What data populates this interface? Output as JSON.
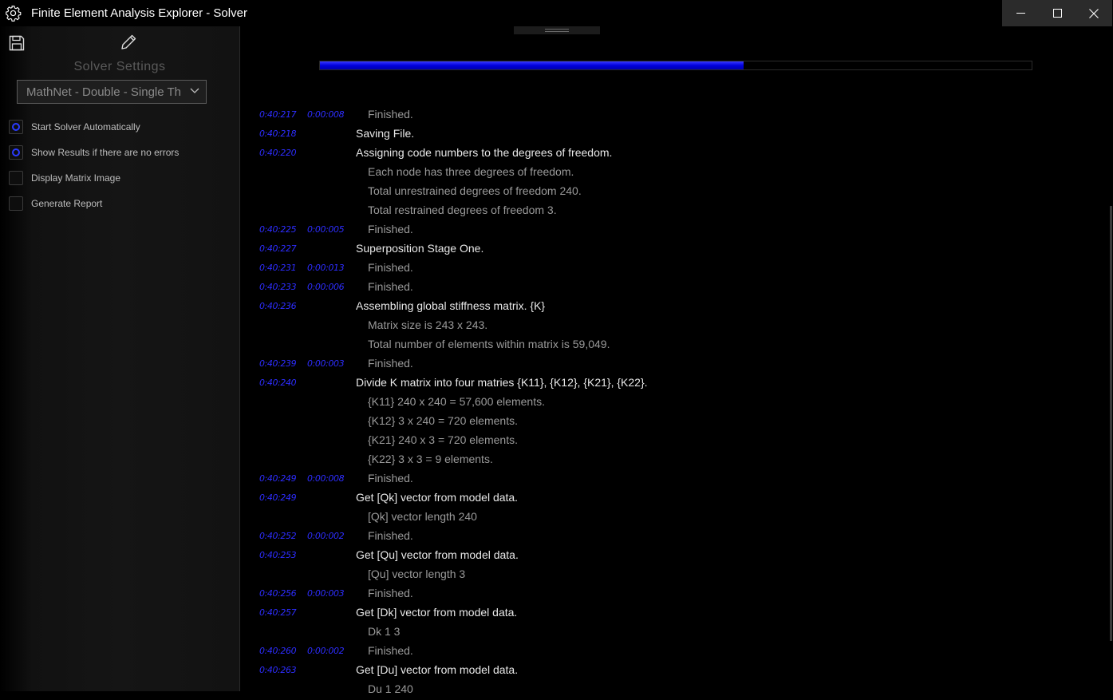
{
  "window": {
    "title": "Finite Element Analysis Explorer - Solver",
    "app_icon": "gear-icon",
    "controls": [
      "minimize-icon",
      "maximize-icon",
      "close-icon"
    ]
  },
  "sidebar": {
    "toolbar": {
      "save_icon": "save-icon",
      "edit_icon": "pencil-icon"
    },
    "settings_title": "Solver Settings",
    "solver_select": {
      "value": "MathNet - Double - Single Th"
    },
    "options": [
      {
        "label": "Start Solver Automatically",
        "checked": true
      },
      {
        "label": "Show Results if there are no errors",
        "checked": true
      },
      {
        "label": "Display Matrix Image",
        "checked": false
      },
      {
        "label": "Generate Report",
        "checked": false
      }
    ]
  },
  "progress": {
    "fraction": 0.595,
    "color": "#0000dd"
  },
  "log": [
    {
      "time": "0:40:217",
      "elapsed": "0:00:008",
      "message": "Finished.",
      "level": "sub"
    },
    {
      "time": "0:40:218",
      "elapsed": "",
      "message": "Saving File.",
      "level": "head"
    },
    {
      "time": "0:40:220",
      "elapsed": "",
      "message": "Assigning code numbers to the degrees of freedom.",
      "level": "head"
    },
    {
      "time": "",
      "elapsed": "",
      "message": "Each node has three degrees of freedom.",
      "level": "sub"
    },
    {
      "time": "",
      "elapsed": "",
      "message": "Total unrestrained degrees of freedom 240.",
      "level": "sub"
    },
    {
      "time": "",
      "elapsed": "",
      "message": "Total restrained degrees of freedom 3.",
      "level": "sub"
    },
    {
      "time": "0:40:225",
      "elapsed": "0:00:005",
      "message": "Finished.",
      "level": "sub"
    },
    {
      "time": "0:40:227",
      "elapsed": "",
      "message": "Superposition Stage One.",
      "level": "head"
    },
    {
      "time": "0:40:231",
      "elapsed": "0:00:013",
      "message": "Finished.",
      "level": "sub"
    },
    {
      "time": "0:40:233",
      "elapsed": "0:00:006",
      "message": "Finished.",
      "level": "sub"
    },
    {
      "time": "0:40:236",
      "elapsed": "",
      "message": "Assembling global stiffness matrix. {K}",
      "level": "head"
    },
    {
      "time": "",
      "elapsed": "",
      "message": "Matrix size is 243 x 243.",
      "level": "sub"
    },
    {
      "time": "",
      "elapsed": "",
      "message": "Total number of elements within matrix is 59,049.",
      "level": "sub"
    },
    {
      "time": "0:40:239",
      "elapsed": "0:00:003",
      "message": "Finished.",
      "level": "sub"
    },
    {
      "time": "0:40:240",
      "elapsed": "",
      "message": "Divide K matrix into four matries {K11}, {K12}, {K21}, {K22}.",
      "level": "head"
    },
    {
      "time": "",
      "elapsed": "",
      "message": "{K11} 240 x 240 = 57,600 elements.",
      "level": "sub"
    },
    {
      "time": "",
      "elapsed": "",
      "message": "{K12} 3 x 240 = 720 elements.",
      "level": "sub"
    },
    {
      "time": "",
      "elapsed": "",
      "message": "{K21} 240 x 3 = 720 elements.",
      "level": "sub"
    },
    {
      "time": "",
      "elapsed": "",
      "message": "{K22} 3 x 3 = 9 elements.",
      "level": "sub"
    },
    {
      "time": "0:40:249",
      "elapsed": "0:00:008",
      "message": "Finished.",
      "level": "sub"
    },
    {
      "time": "0:40:249",
      "elapsed": "",
      "message": "Get [Qk] vector from model data.",
      "level": "head"
    },
    {
      "time": "",
      "elapsed": "",
      "message": "[Qk] vector length 240",
      "level": "sub"
    },
    {
      "time": "0:40:252",
      "elapsed": "0:00:002",
      "message": "Finished.",
      "level": "sub"
    },
    {
      "time": "0:40:253",
      "elapsed": "",
      "message": "Get [Qu] vector from model data.",
      "level": "head"
    },
    {
      "time": "",
      "elapsed": "",
      "message": "[Qu] vector length 3",
      "level": "sub"
    },
    {
      "time": "0:40:256",
      "elapsed": "0:00:003",
      "message": "Finished.",
      "level": "sub"
    },
    {
      "time": "0:40:257",
      "elapsed": "",
      "message": "Get [Dk] vector from model data.",
      "level": "head"
    },
    {
      "time": "",
      "elapsed": "",
      "message": "Dk 1 3",
      "level": "sub"
    },
    {
      "time": "0:40:260",
      "elapsed": "0:00:002",
      "message": "Finished.",
      "level": "sub"
    },
    {
      "time": "0:40:263",
      "elapsed": "",
      "message": "Get [Du] vector from model data.",
      "level": "head"
    },
    {
      "time": "",
      "elapsed": "",
      "message": "Du 1 240",
      "level": "sub"
    }
  ]
}
